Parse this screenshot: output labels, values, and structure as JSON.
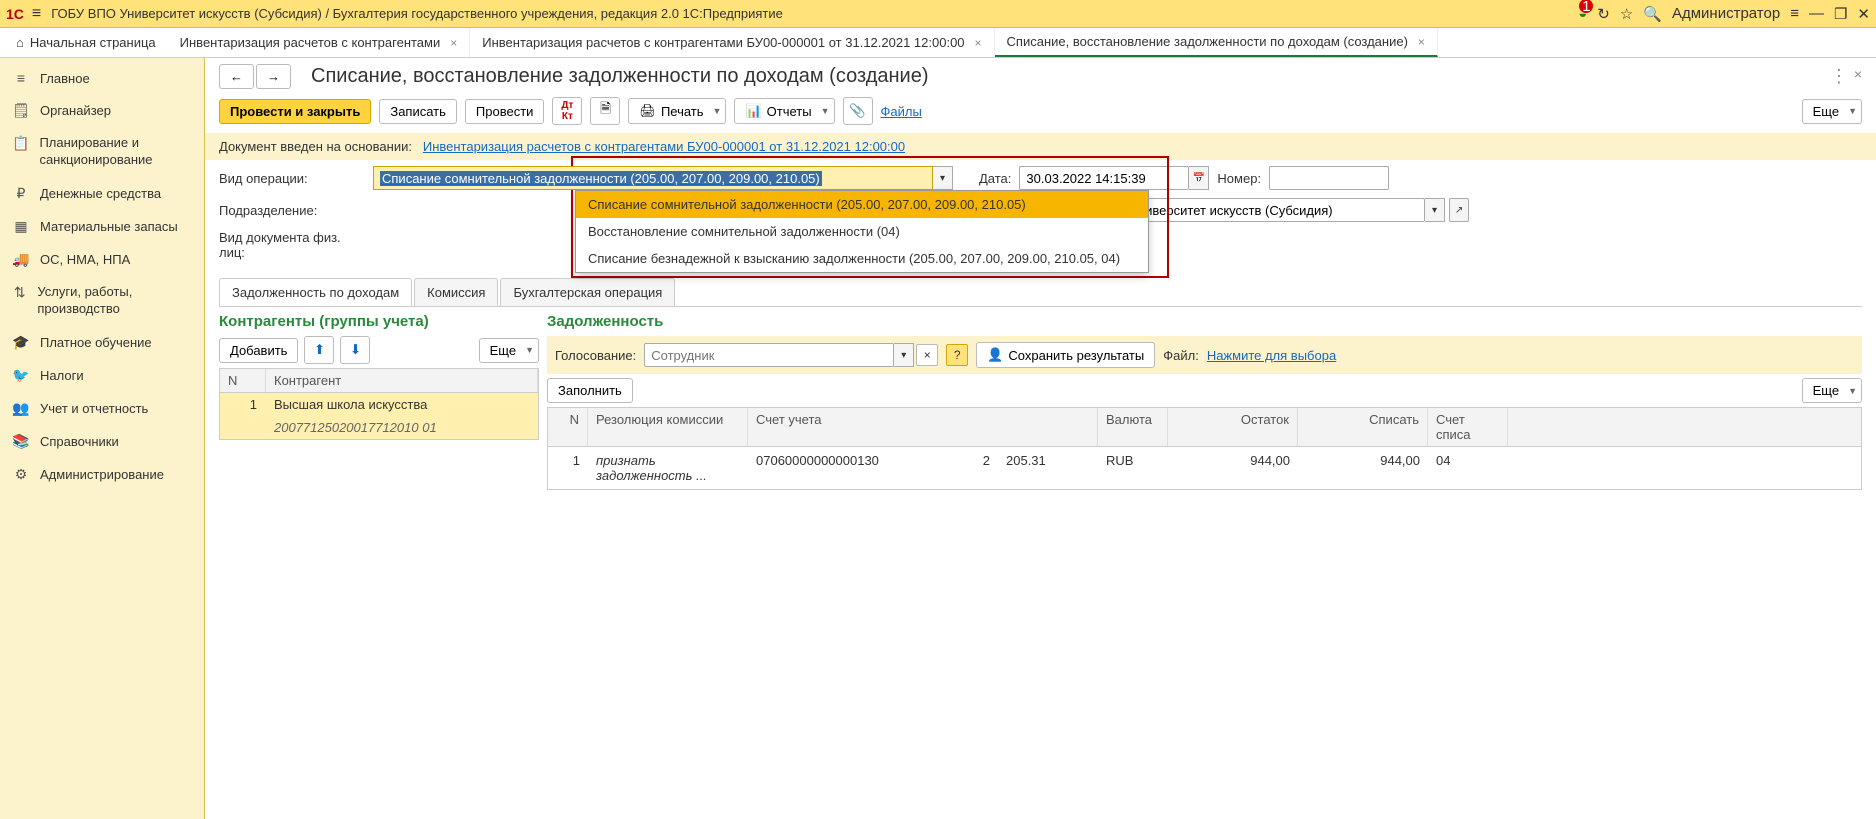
{
  "titlebar": {
    "app": "1С",
    "text": "ГОБУ ВПО Университет искусств (Субсидия) / Бухгалтерия государственного учреждения, редакция 2.0 1С:Предприятие",
    "badge": "1",
    "user": "Администратор"
  },
  "tabs": {
    "home": "Начальная страница",
    "items": [
      {
        "label": "Инвентаризация расчетов с контрагентами"
      },
      {
        "label": "Инвентаризация расчетов с контрагентами БУ00-000001 от 31.12.2021 12:00:00"
      },
      {
        "label": "Списание, восстановление задолженности по доходам (создание)",
        "active": true
      }
    ]
  },
  "sidebar": {
    "items": [
      {
        "icon": "≡",
        "label": "Главное"
      },
      {
        "icon": "🗒",
        "label": "Органайзер"
      },
      {
        "icon": "📋",
        "label": "Планирование и санкционирование",
        "multi": true
      },
      {
        "icon": "₽",
        "label": "Денежные средства"
      },
      {
        "icon": "▦",
        "label": "Материальные запасы"
      },
      {
        "icon": "🚚",
        "label": "ОС, НМА, НПА"
      },
      {
        "icon": "⇅",
        "label": "Услуги, работы, производство",
        "multi": true
      },
      {
        "icon": "🎓",
        "label": "Платное обучение"
      },
      {
        "icon": "🐦",
        "label": "Налоги"
      },
      {
        "icon": "👥",
        "label": "Учет и отчетность"
      },
      {
        "icon": "📚",
        "label": "Справочники"
      },
      {
        "icon": "⚙",
        "label": "Администрирование"
      }
    ]
  },
  "page": {
    "title": "Списание, восстановление задолженности по доходам (создание)"
  },
  "toolbar": {
    "post_close": "Провести и закрыть",
    "save": "Записать",
    "post": "Провести",
    "print": "Печать",
    "reports": "Отчеты",
    "files": "Файлы",
    "more": "Еще"
  },
  "info_line": {
    "prefix": "Документ введен на основании:",
    "link": "Инвентаризация расчетов с контрагентами БУ00-000001 от 31.12.2021 12:00:00"
  },
  "form": {
    "op_label": "Вид операции:",
    "op_value": "Списание сомнительной задолженности (205.00, 207.00, 209.00, 210.05)",
    "op_options": [
      "Списание сомнительной задолженности (205.00, 207.00, 209.00, 210.05)",
      "Восстановление сомнительной задолженности (04)",
      "Списание безнадежной к взысканию задолженности (205.00, 207.00, 209.00, 210.05, 04)"
    ],
    "date_label": "Дата:",
    "date_value": "30.03.2022 14:15:39",
    "num_label": "Номер:",
    "dept_label": "Подразделение:",
    "org_label": "Организация:",
    "org_value": "ГОБУ ВПО Университет искусств (Субсидия)",
    "doctype_label": "Вид документа физ. лиц:"
  },
  "subtabs": {
    "items": [
      "Задолженность по доходам",
      "Комиссия",
      "Бухгалтерская операция"
    ]
  },
  "left_panel": {
    "title": "Контрагенты (группы учета)",
    "add": "Добавить",
    "more": "Еще",
    "col_n": "N",
    "col_name": "Контрагент",
    "row": {
      "n": "1",
      "name": "Высшая школа искусства",
      "code": "20077125020017712010 01"
    }
  },
  "right_panel": {
    "title": "Задолженность",
    "vote_label": "Голосование:",
    "vote_placeholder": "Сотрудник",
    "save_results": "Сохранить результаты",
    "file_label": "Файл:",
    "file_link": "Нажмите для выбора",
    "fill": "Заполнить",
    "more": "Еще",
    "cols": {
      "n": "N",
      "res": "Резолюция комиссии",
      "acc": "Счет учета",
      "cur": "Валюта",
      "bal": "Остаток",
      "wr": "Списать",
      "aw": "Счет списа"
    },
    "row": {
      "n": "1",
      "res": "признать задолженность ...",
      "acc": "07060000000000130",
      "accn": "2",
      "acc2": "205.31",
      "cur": "RUB",
      "bal": "944,00",
      "wr": "944,00",
      "aw": "04"
    }
  }
}
